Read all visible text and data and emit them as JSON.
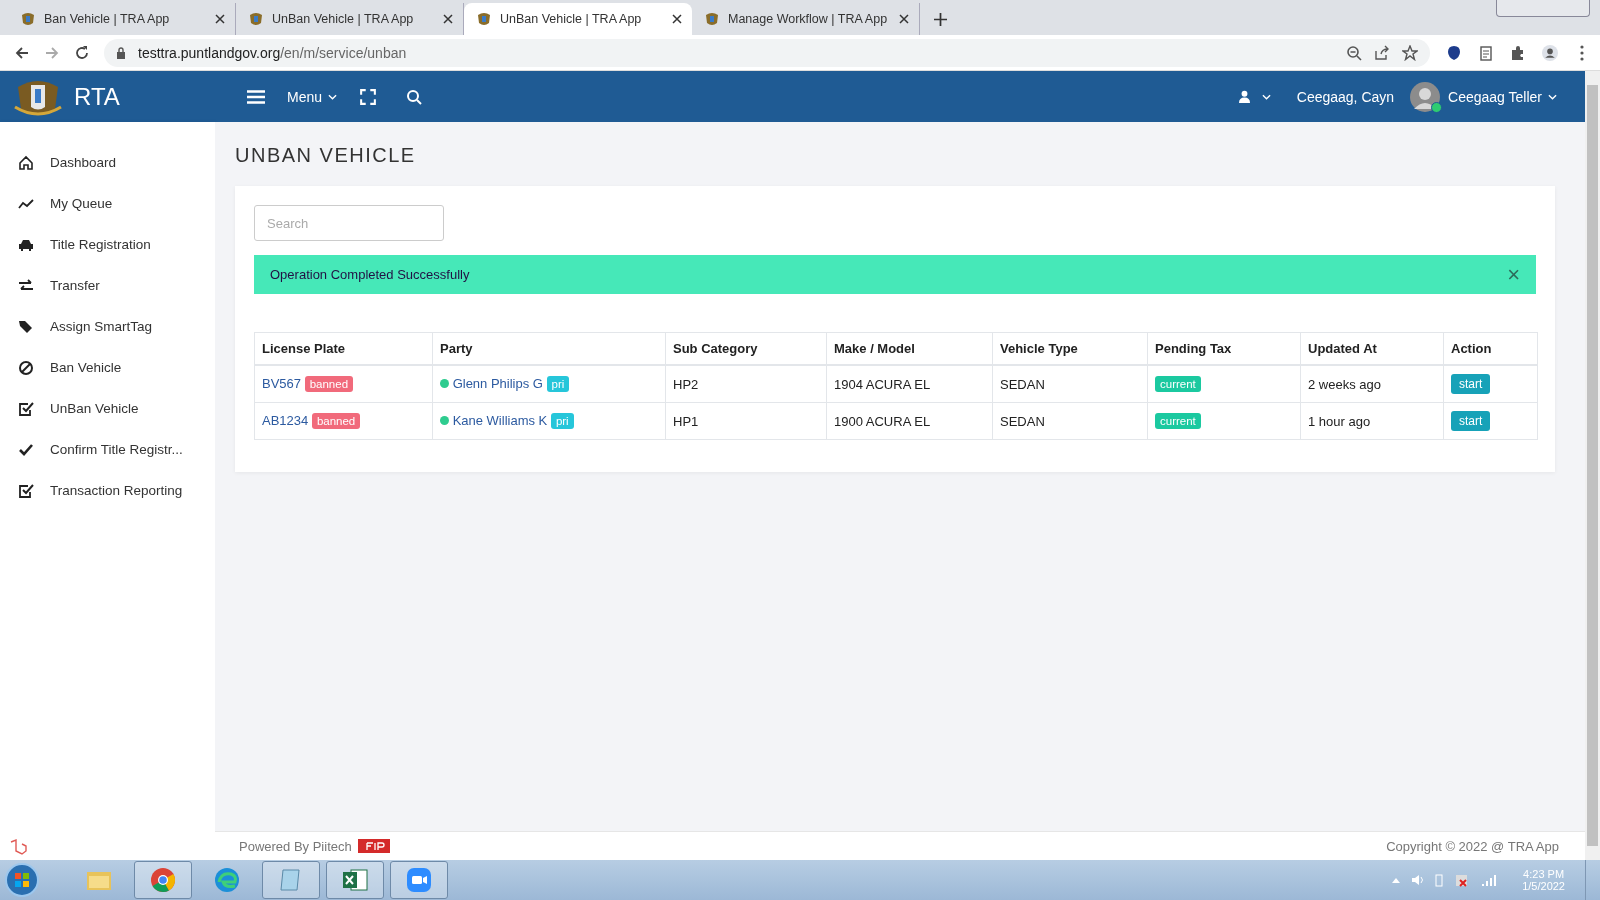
{
  "browser": {
    "tabs": [
      {
        "title": "Ban Vehicle | TRA App",
        "selected": false
      },
      {
        "title": "UnBan Vehicle | TRA App",
        "selected": false
      },
      {
        "title": "UnBan Vehicle | TRA App",
        "selected": true
      },
      {
        "title": "Manage Workflow | TRA App",
        "selected": false
      }
    ],
    "url_host": "testtra.puntlandgov.org",
    "url_path": "/en/m/service/unban"
  },
  "header": {
    "brand": "RTA",
    "menu_label": "Menu",
    "user_short": "Ceegaag, Cayn",
    "user_name": "Ceegaag Teller",
    "online": true
  },
  "sidebar": {
    "items": [
      {
        "kind": "home",
        "label": "Dashboard"
      },
      {
        "kind": "trend",
        "label": "My Queue"
      },
      {
        "kind": "car",
        "label": "Title Registration"
      },
      {
        "kind": "transfer",
        "label": "Transfer"
      },
      {
        "kind": "tags",
        "label": "Assign SmartTag"
      },
      {
        "kind": "ban",
        "label": "Ban Vehicle"
      },
      {
        "kind": "checkbox",
        "label": "UnBan Vehicle"
      },
      {
        "kind": "check",
        "label": "Confirm Title Registr..."
      },
      {
        "kind": "checkbox",
        "label": "Transaction Reporting"
      }
    ]
  },
  "page": {
    "title": "UNBAN VEHICLE",
    "search": {
      "placeholder": "Search"
    },
    "alert": {
      "message": "Operation Completed Successfully",
      "close": "×"
    },
    "table": {
      "columns": [
        "License Plate",
        "Party",
        "Sub Category",
        "Make / Model",
        "Vehicle Type",
        "Pending Tax",
        "Updated At",
        "Action"
      ],
      "rows": [
        {
          "plate": "BV567",
          "plate_badge": "banned",
          "party": "Glenn Philips G",
          "party_badge": "pri",
          "sub_category": "HP2",
          "make_model": "1904 ACURA EL",
          "vehicle_type": "SEDAN",
          "pending_tax": "current",
          "updated_at": "2 weeks ago",
          "action": "start"
        },
        {
          "plate": "AB1234",
          "plate_badge": "banned",
          "party": "Kane Williams K",
          "party_badge": "pri",
          "sub_category": "HP1",
          "make_model": "1900 ACURA EL",
          "vehicle_type": "SEDAN",
          "pending_tax": "current",
          "updated_at": "1 hour ago",
          "action": "start"
        }
      ]
    }
  },
  "footer": {
    "powered": "Powered By Piitech",
    "copyright": "Copyright © 2022 @ TRA App"
  },
  "taskbar": {
    "apps": [
      {
        "kind": "folder",
        "running": false
      },
      {
        "kind": "chrome",
        "running": true
      },
      {
        "kind": "edge",
        "running": false
      },
      {
        "kind": "notepad",
        "running": true
      },
      {
        "kind": "excel",
        "running": true
      },
      {
        "kind": "zoom",
        "running": true
      }
    ],
    "time": "4:23 PM",
    "date": "1/5/2022"
  }
}
